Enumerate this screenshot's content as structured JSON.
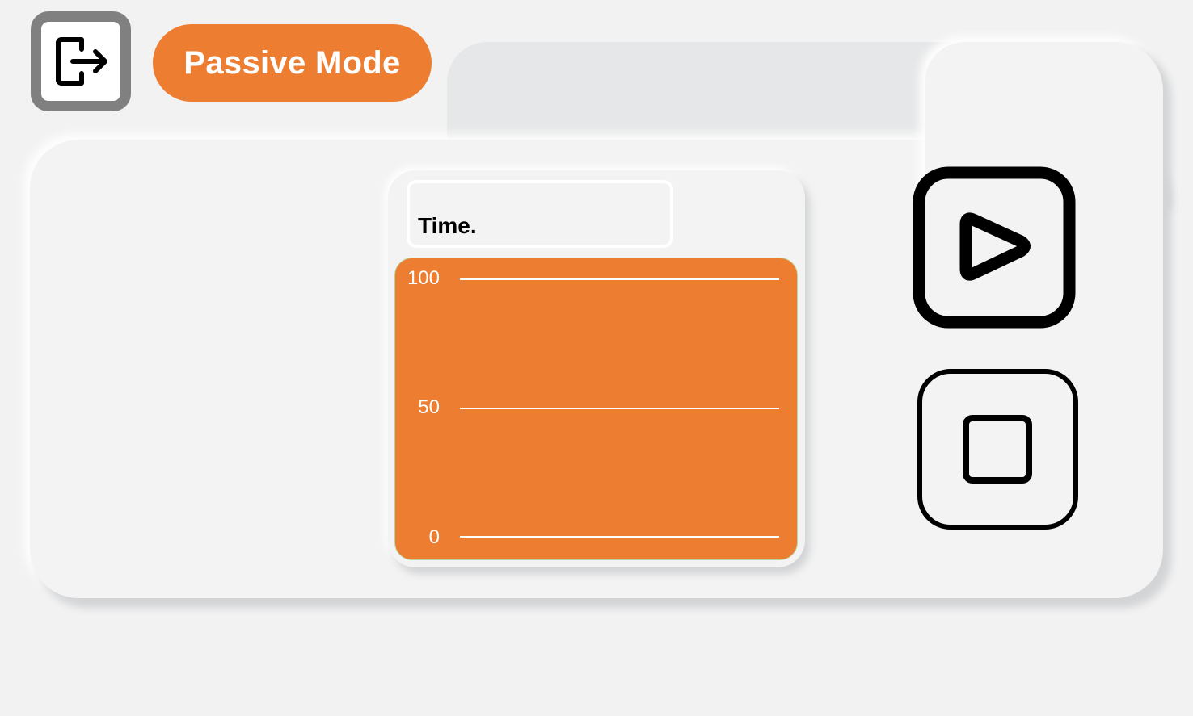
{
  "header": {
    "exit_icon": "exit-arrow-icon",
    "mode_label": "Passive Mode"
  },
  "chart": {
    "title": "Time.",
    "colors": {
      "plot_background": "#ed7d31",
      "gridline": "#ffffff"
    }
  },
  "chart_data": {
    "type": "line",
    "title": "Time.",
    "xlabel": "",
    "ylabel": "",
    "ylim": [
      0,
      100
    ],
    "y_ticks": [
      "100",
      "50",
      "0"
    ],
    "series": [],
    "grid": true
  },
  "controls": {
    "play_icon": "play-icon",
    "stop_icon": "stop-icon"
  },
  "colors": {
    "accent": "#ed7d31",
    "exit_border": "#808080",
    "panel": "#f3f3f3",
    "tab": "#e6e7e8"
  }
}
